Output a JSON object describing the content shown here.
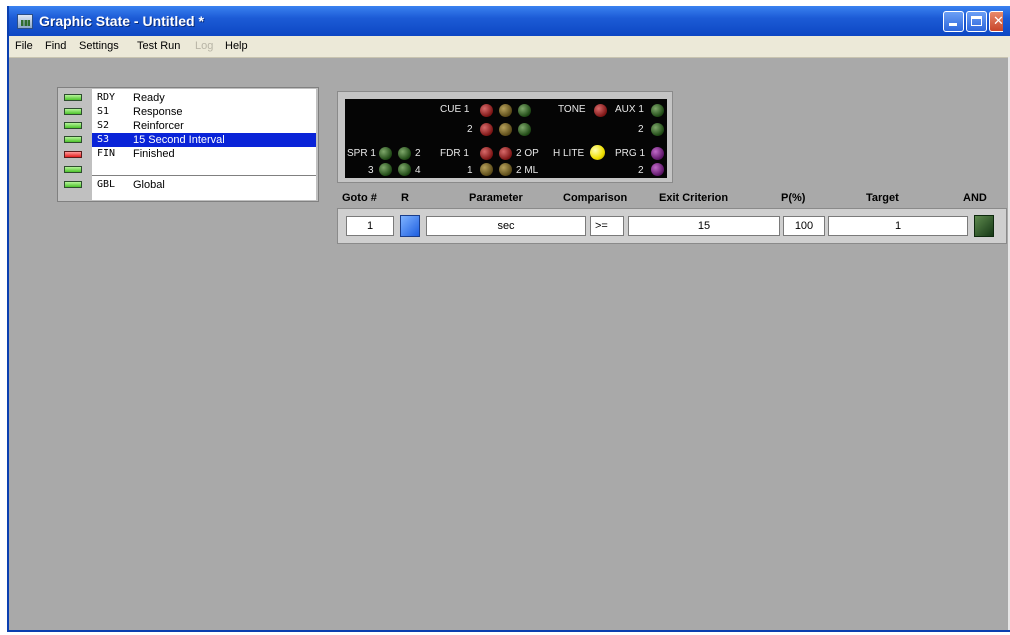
{
  "window": {
    "title": "Graphic State - Untitled *"
  },
  "menu": [
    "File",
    "Find",
    "Settings",
    "Test Run",
    "Log",
    "Help"
  ],
  "menu_disabled": [
    "Log"
  ],
  "states": [
    {
      "code": "RDY",
      "name": "Ready",
      "led": "green"
    },
    {
      "code": "S1",
      "name": "Response",
      "led": "green"
    },
    {
      "code": "S2",
      "name": "Reinforcer",
      "led": "green"
    },
    {
      "code": "S3",
      "name": "15 Second Interval",
      "led": "green",
      "selected": true
    },
    {
      "code": "FIN",
      "name": "Finished",
      "led": "red"
    },
    {
      "code": "",
      "name": "",
      "led": "green"
    },
    {
      "code": "GBL",
      "name": "Global",
      "led": "green"
    }
  ],
  "io": {
    "cue1": "CUE 1",
    "cue2": "2",
    "tone": "TONE",
    "aux1": "AUX 1",
    "aux2": "2",
    "spr1": "SPR 1",
    "spr2": "2",
    "spr3": "3",
    "spr4": "4",
    "fdr1": "FDR 1",
    "fdr1b": "1",
    "op2": "2 OP",
    "ml2": "2 ML",
    "hlite": "H LITE",
    "prg1": "PRG 1",
    "prg2": "2"
  },
  "transition": {
    "headers": {
      "goto": "Goto #",
      "r": "R",
      "parameter": "Parameter",
      "comparison": "Comparison",
      "exit": "Exit Criterion",
      "p": "P(%)",
      "target": "Target",
      "and": "AND"
    },
    "row": {
      "goto": "1",
      "parameter": "sec",
      "comparison": ">=",
      "exit": "15",
      "p": "100",
      "target": "1"
    }
  },
  "colors": {
    "titlebar": "#0d47c4",
    "selected_row": "#0a24d8",
    "window_bg": "#a9a9a9"
  }
}
